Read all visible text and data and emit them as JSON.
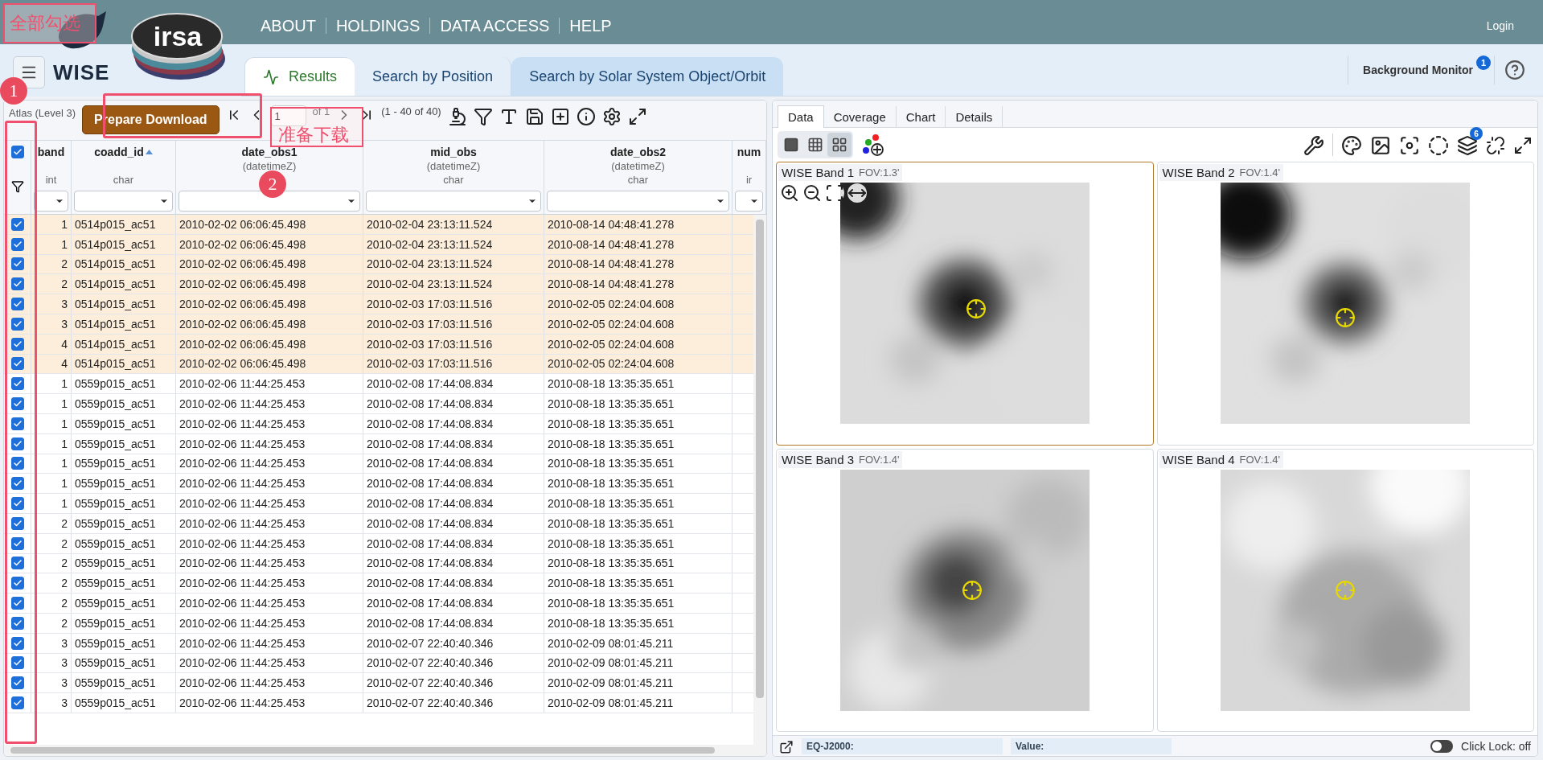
{
  "header": {
    "mission_logo": "WISE",
    "archive_logo": "irsa",
    "nav": [
      "ABOUT",
      "HOLDINGS",
      "DATA ACCESS",
      "HELP"
    ],
    "login": "Login"
  },
  "tabs": [
    {
      "label": "Results",
      "selected": true,
      "hovered": false
    },
    {
      "label": "Search by Position",
      "selected": false,
      "hovered": false
    },
    {
      "label": "Search by Solar System Object/Orbit",
      "selected": false,
      "hovered": true
    }
  ],
  "background_monitor": {
    "label": "Background Monitor",
    "badge": "1"
  },
  "table": {
    "title": "Atlas (Level 3)",
    "download_button": "Prepare Download",
    "pager": {
      "page": "1",
      "of": "of 1",
      "range": "(1 - 40 of 40)"
    },
    "all_selected": true,
    "columns": [
      {
        "name": "band",
        "type": "int",
        "sorted": false
      },
      {
        "name": "coadd_id",
        "type": "char",
        "sorted": true
      },
      {
        "name": "date_obs1",
        "unit": "(datetimeZ)",
        "sorted": false
      },
      {
        "name": "mid_obs",
        "unit": "(datetimeZ)",
        "type": "char",
        "sorted": false
      },
      {
        "name": "date_obs2",
        "unit": "(datetimeZ)",
        "type": "char",
        "sorted": false
      },
      {
        "name": "num",
        "type": "ir",
        "sorted": false
      }
    ],
    "rows": [
      {
        "selected": true,
        "highlighted": true,
        "cells": [
          "1",
          "0514p015_ac51",
          "2010-02-02 06:06:45.498",
          "2010-02-04 23:13:11.524",
          "2010-08-14 04:48:41.278"
        ]
      },
      {
        "selected": true,
        "highlighted": true,
        "cells": [
          "1",
          "0514p015_ac51",
          "2010-02-02 06:06:45.498",
          "2010-02-04 23:13:11.524",
          "2010-08-14 04:48:41.278"
        ]
      },
      {
        "selected": true,
        "highlighted": true,
        "cells": [
          "2",
          "0514p015_ac51",
          "2010-02-02 06:06:45.498",
          "2010-02-04 23:13:11.524",
          "2010-08-14 04:48:41.278"
        ]
      },
      {
        "selected": true,
        "highlighted": true,
        "cells": [
          "2",
          "0514p015_ac51",
          "2010-02-02 06:06:45.498",
          "2010-02-04 23:13:11.524",
          "2010-08-14 04:48:41.278"
        ]
      },
      {
        "selected": true,
        "highlighted": true,
        "cells": [
          "3",
          "0514p015_ac51",
          "2010-02-02 06:06:45.498",
          "2010-02-03 17:03:11.516",
          "2010-02-05 02:24:04.608"
        ]
      },
      {
        "selected": true,
        "highlighted": true,
        "cells": [
          "3",
          "0514p015_ac51",
          "2010-02-02 06:06:45.498",
          "2010-02-03 17:03:11.516",
          "2010-02-05 02:24:04.608"
        ]
      },
      {
        "selected": true,
        "highlighted": true,
        "cells": [
          "4",
          "0514p015_ac51",
          "2010-02-02 06:06:45.498",
          "2010-02-03 17:03:11.516",
          "2010-02-05 02:24:04.608"
        ]
      },
      {
        "selected": true,
        "highlighted": true,
        "cells": [
          "4",
          "0514p015_ac51",
          "2010-02-02 06:06:45.498",
          "2010-02-03 17:03:11.516",
          "2010-02-05 02:24:04.608"
        ]
      },
      {
        "selected": true,
        "highlighted": false,
        "cells": [
          "1",
          "0559p015_ac51",
          "2010-02-06 11:44:25.453",
          "2010-02-08 17:44:08.834",
          "2010-08-18 13:35:35.651"
        ]
      },
      {
        "selected": true,
        "highlighted": false,
        "cells": [
          "1",
          "0559p015_ac51",
          "2010-02-06 11:44:25.453",
          "2010-02-08 17:44:08.834",
          "2010-08-18 13:35:35.651"
        ]
      },
      {
        "selected": true,
        "highlighted": false,
        "cells": [
          "1",
          "0559p015_ac51",
          "2010-02-06 11:44:25.453",
          "2010-02-08 17:44:08.834",
          "2010-08-18 13:35:35.651"
        ]
      },
      {
        "selected": true,
        "highlighted": false,
        "cells": [
          "1",
          "0559p015_ac51",
          "2010-02-06 11:44:25.453",
          "2010-02-08 17:44:08.834",
          "2010-08-18 13:35:35.651"
        ]
      },
      {
        "selected": true,
        "highlighted": false,
        "cells": [
          "1",
          "0559p015_ac51",
          "2010-02-06 11:44:25.453",
          "2010-02-08 17:44:08.834",
          "2010-08-18 13:35:35.651"
        ]
      },
      {
        "selected": true,
        "highlighted": false,
        "cells": [
          "1",
          "0559p015_ac51",
          "2010-02-06 11:44:25.453",
          "2010-02-08 17:44:08.834",
          "2010-08-18 13:35:35.651"
        ]
      },
      {
        "selected": true,
        "highlighted": false,
        "cells": [
          "1",
          "0559p015_ac51",
          "2010-02-06 11:44:25.453",
          "2010-02-08 17:44:08.834",
          "2010-08-18 13:35:35.651"
        ]
      },
      {
        "selected": true,
        "highlighted": false,
        "cells": [
          "2",
          "0559p015_ac51",
          "2010-02-06 11:44:25.453",
          "2010-02-08 17:44:08.834",
          "2010-08-18 13:35:35.651"
        ]
      },
      {
        "selected": true,
        "highlighted": false,
        "cells": [
          "2",
          "0559p015_ac51",
          "2010-02-06 11:44:25.453",
          "2010-02-08 17:44:08.834",
          "2010-08-18 13:35:35.651"
        ]
      },
      {
        "selected": true,
        "highlighted": false,
        "cells": [
          "2",
          "0559p015_ac51",
          "2010-02-06 11:44:25.453",
          "2010-02-08 17:44:08.834",
          "2010-08-18 13:35:35.651"
        ]
      },
      {
        "selected": true,
        "highlighted": false,
        "cells": [
          "2",
          "0559p015_ac51",
          "2010-02-06 11:44:25.453",
          "2010-02-08 17:44:08.834",
          "2010-08-18 13:35:35.651"
        ]
      },
      {
        "selected": true,
        "highlighted": false,
        "cells": [
          "2",
          "0559p015_ac51",
          "2010-02-06 11:44:25.453",
          "2010-02-08 17:44:08.834",
          "2010-08-18 13:35:35.651"
        ]
      },
      {
        "selected": true,
        "highlighted": false,
        "cells": [
          "2",
          "0559p015_ac51",
          "2010-02-06 11:44:25.453",
          "2010-02-08 17:44:08.834",
          "2010-08-18 13:35:35.651"
        ]
      },
      {
        "selected": true,
        "highlighted": false,
        "cells": [
          "3",
          "0559p015_ac51",
          "2010-02-06 11:44:25.453",
          "2010-02-07 22:40:40.346",
          "2010-02-09 08:01:45.211"
        ]
      },
      {
        "selected": true,
        "highlighted": false,
        "cells": [
          "3",
          "0559p015_ac51",
          "2010-02-06 11:44:25.453",
          "2010-02-07 22:40:40.346",
          "2010-02-09 08:01:45.211"
        ]
      },
      {
        "selected": true,
        "highlighted": false,
        "cells": [
          "3",
          "0559p015_ac51",
          "2010-02-06 11:44:25.453",
          "2010-02-07 22:40:40.346",
          "2010-02-09 08:01:45.211"
        ]
      },
      {
        "selected": true,
        "highlighted": false,
        "cells": [
          "3",
          "0559p015_ac51",
          "2010-02-06 11:44:25.453",
          "2010-02-07 22:40:40.346",
          "2010-02-09 08:01:45.211"
        ]
      }
    ]
  },
  "viewer": {
    "tabs": [
      {
        "label": "Data",
        "selected": true
      },
      {
        "label": "Coverage",
        "selected": false
      },
      {
        "label": "Chart",
        "selected": false
      },
      {
        "label": "Details",
        "selected": false
      }
    ],
    "layouts": [
      {
        "kind": "single",
        "selected": false
      },
      {
        "kind": "grid3",
        "selected": false
      },
      {
        "kind": "grid2",
        "selected": true
      }
    ],
    "layers_badge": "6",
    "images": [
      {
        "title": "WISE Band 1",
        "fov": "FOV:1.3'",
        "selected": true
      },
      {
        "title": "WISE Band 2",
        "fov": "FOV:1.4'",
        "selected": false
      },
      {
        "title": "WISE Band 3",
        "fov": "FOV:1.4'",
        "selected": false
      },
      {
        "title": "WISE Band 4",
        "fov": "FOV:1.4'",
        "selected": false
      }
    ],
    "status": {
      "coords_label": "EQ-J2000:",
      "value_label": "Value:",
      "click_lock": "Click Lock: off",
      "lock_on": false
    }
  },
  "annotations": {
    "select_all_label": "全部勾选",
    "download_label": "准备下载",
    "steps": [
      "1",
      "2"
    ]
  }
}
